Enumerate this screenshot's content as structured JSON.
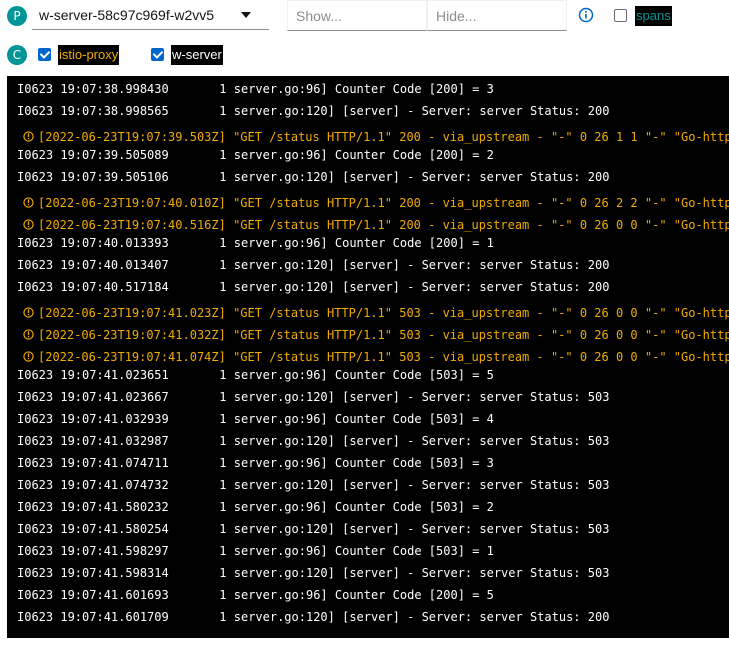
{
  "toolbar": {
    "pod_badge": "P",
    "pod_name": "w-server-58c97c969f-w2vv5",
    "show_placeholder": "Show...",
    "hide_placeholder": "Hide...",
    "spans_label": "spans",
    "spans_checked": false
  },
  "containers": {
    "badge": "C",
    "items": [
      {
        "label": "istio-proxy",
        "checked": true,
        "color": "#f0ab00"
      },
      {
        "label": "w-server",
        "checked": true,
        "color": "#ffffff"
      }
    ]
  },
  "colors": {
    "badge": "#009596",
    "accent": "#0066cc",
    "proxy_text": "#f0ab00",
    "server_text": "#ffffff",
    "spans_text": "#009596",
    "log_background": "#000000"
  },
  "log_lines": [
    {
      "source": "server",
      "text": "I0623 19:07:38.998430       1 server.go:96] Counter Code [200] = 3"
    },
    {
      "source": "server",
      "text": "I0623 19:07:38.998565       1 server.go:120] [server] - Server: server Status: 200"
    },
    {
      "source": "proxy",
      "text": "[2022-06-23T19:07:39.503Z] \"GET /status HTTP/1.1\" 200 - via_upstream - \"-\" 0 26 1 1 \"-\" \"Go-http"
    },
    {
      "source": "server",
      "text": "I0623 19:07:39.505089       1 server.go:96] Counter Code [200] = 2"
    },
    {
      "source": "server",
      "text": "I0623 19:07:39.505106       1 server.go:120] [server] - Server: server Status: 200"
    },
    {
      "source": "proxy",
      "text": "[2022-06-23T19:07:40.010Z] \"GET /status HTTP/1.1\" 200 - via_upstream - \"-\" 0 26 2 2 \"-\" \"Go-http"
    },
    {
      "source": "proxy",
      "text": "[2022-06-23T19:07:40.516Z] \"GET /status HTTP/1.1\" 200 - via_upstream - \"-\" 0 26 0 0 \"-\" \"Go-http"
    },
    {
      "source": "server",
      "text": "I0623 19:07:40.013393       1 server.go:96] Counter Code [200] = 1"
    },
    {
      "source": "server",
      "text": "I0623 19:07:40.013407       1 server.go:120] [server] - Server: server Status: 200"
    },
    {
      "source": "server",
      "text": "I0623 19:07:40.517184       1 server.go:120] [server] - Server: server Status: 200"
    },
    {
      "source": "proxy",
      "text": "[2022-06-23T19:07:41.023Z] \"GET /status HTTP/1.1\" 503 - via_upstream - \"-\" 0 26 0 0 \"-\" \"Go-http"
    },
    {
      "source": "proxy",
      "text": "[2022-06-23T19:07:41.032Z] \"GET /status HTTP/1.1\" 503 - via_upstream - \"-\" 0 26 0 0 \"-\" \"Go-http"
    },
    {
      "source": "proxy",
      "text": "[2022-06-23T19:07:41.074Z] \"GET /status HTTP/1.1\" 503 - via_upstream - \"-\" 0 26 0 0 \"-\" \"Go-http"
    },
    {
      "source": "server",
      "text": "I0623 19:07:41.023651       1 server.go:96] Counter Code [503] = 5"
    },
    {
      "source": "server",
      "text": "I0623 19:07:41.023667       1 server.go:120] [server] - Server: server Status: 503"
    },
    {
      "source": "server",
      "text": "I0623 19:07:41.032939       1 server.go:96] Counter Code [503] = 4"
    },
    {
      "source": "server",
      "text": "I0623 19:07:41.032987       1 server.go:120] [server] - Server: server Status: 503"
    },
    {
      "source": "server",
      "text": "I0623 19:07:41.074711       1 server.go:96] Counter Code [503] = 3"
    },
    {
      "source": "server",
      "text": "I0623 19:07:41.074732       1 server.go:120] [server] - Server: server Status: 503"
    },
    {
      "source": "server",
      "text": "I0623 19:07:41.580232       1 server.go:96] Counter Code [503] = 2"
    },
    {
      "source": "server",
      "text": "I0623 19:07:41.580254       1 server.go:120] [server] - Server: server Status: 503"
    },
    {
      "source": "server",
      "text": "I0623 19:07:41.598297       1 server.go:96] Counter Code [503] = 1"
    },
    {
      "source": "server",
      "text": "I0623 19:07:41.598314       1 server.go:120] [server] - Server: server Status: 503"
    },
    {
      "source": "server",
      "text": "I0623 19:07:41.601693       1 server.go:96] Counter Code [200] = 5"
    },
    {
      "source": "server",
      "text": "I0623 19:07:41.601709       1 server.go:120] [server] - Server: server Status: 200"
    }
  ]
}
